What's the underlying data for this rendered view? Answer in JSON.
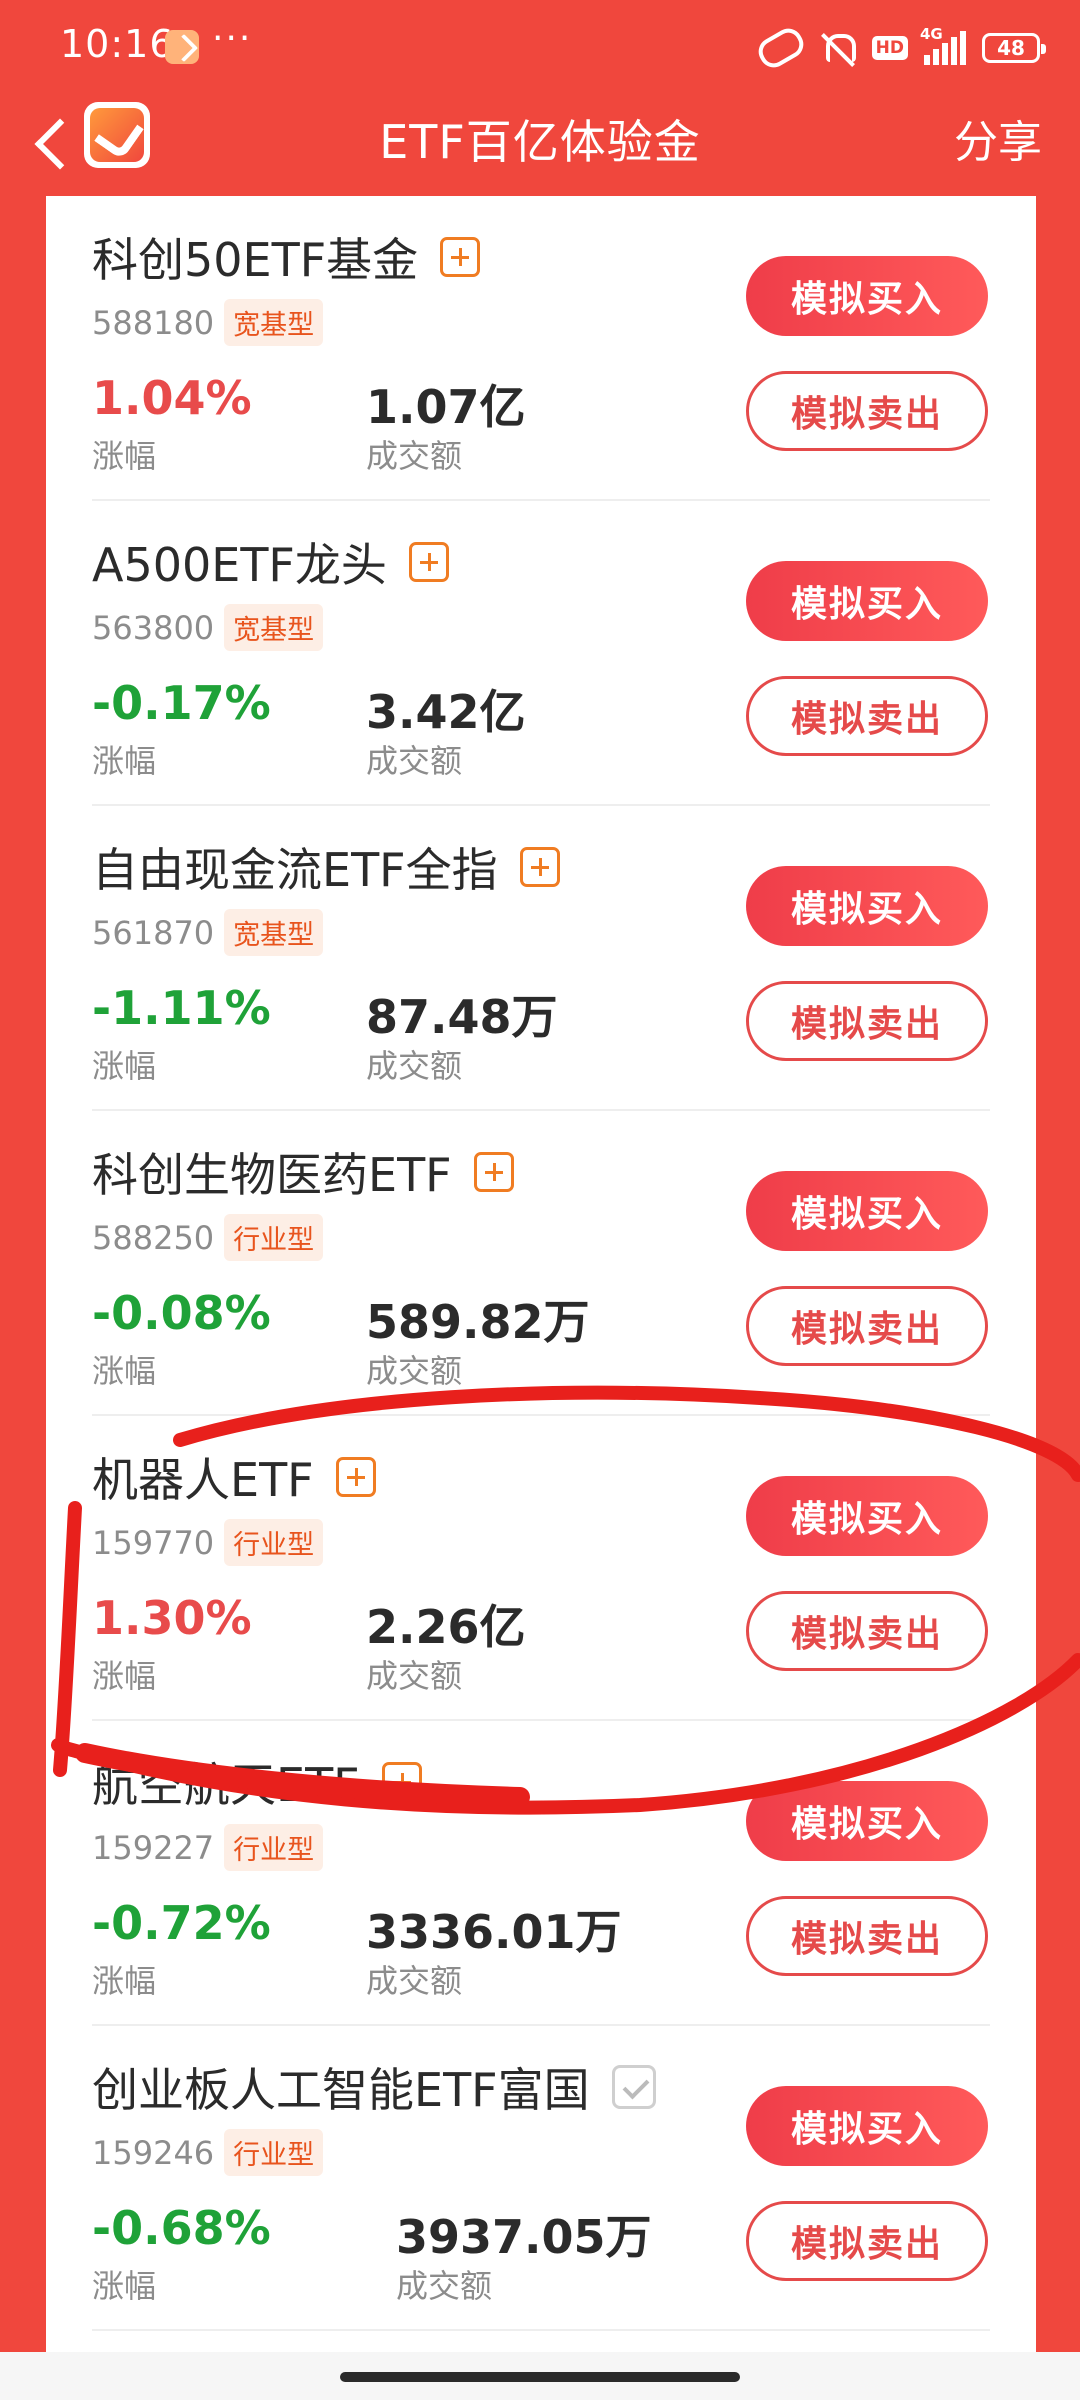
{
  "status_bar": {
    "time": "10:16",
    "more": "···",
    "network": "4G",
    "hd": "HD",
    "battery": "48"
  },
  "nav": {
    "title": "ETF百亿体验金",
    "share": "分享"
  },
  "labels": {
    "change": "涨幅",
    "turnover": "成交额",
    "buy": "模拟买入",
    "sell": "模拟卖出"
  },
  "funds": [
    {
      "name": "科创50ETF基金",
      "code": "588180",
      "tag": "宽基型",
      "change": "1.04%",
      "direction": "up",
      "turnover": "1.07亿",
      "added": false
    },
    {
      "name": "A500ETF龙头",
      "code": "563800",
      "tag": "宽基型",
      "change": "-0.17%",
      "direction": "down",
      "turnover": "3.42亿",
      "added": false
    },
    {
      "name": "自由现金流ETF全指",
      "code": "561870",
      "tag": "宽基型",
      "change": "-1.11%",
      "direction": "down",
      "turnover": "87.48万",
      "added": false
    },
    {
      "name": "科创生物医药ETF",
      "code": "588250",
      "tag": "行业型",
      "change": "-0.08%",
      "direction": "down",
      "turnover": "589.82万",
      "added": false
    },
    {
      "name": "机器人ETF",
      "code": "159770",
      "tag": "行业型",
      "change": "1.30%",
      "direction": "up",
      "turnover": "2.26亿",
      "added": false
    },
    {
      "name": "航空航天ETF",
      "code": "159227",
      "tag": "行业型",
      "change": "-0.72%",
      "direction": "down",
      "turnover": "3336.01万",
      "added": false
    },
    {
      "name": "创业板人工智能ETF富国",
      "code": "159246",
      "tag": "行业型",
      "change": "-0.68%",
      "direction": "down",
      "turnover": "3937.05万",
      "added": true
    }
  ],
  "colors": {
    "brand_red": "#f0473d",
    "up": "#e84b4b",
    "down": "#1fa238",
    "tag_text": "#e8541d",
    "annotation": "#e8201c"
  }
}
